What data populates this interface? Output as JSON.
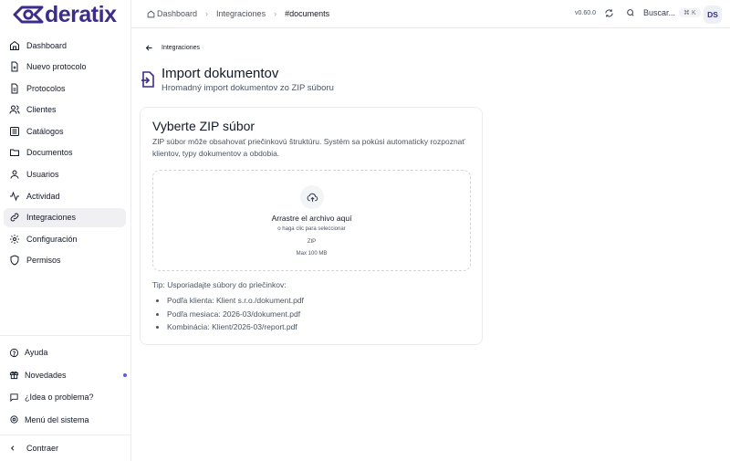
{
  "brand": {
    "logo_text": "deratix",
    "color": "#3b2d8a"
  },
  "sidebar": {
    "items": [
      {
        "label": "Dashboard",
        "icon": "home-icon"
      },
      {
        "label": "Nuevo protocolo",
        "icon": "file-plus-icon"
      },
      {
        "label": "Protocolos",
        "icon": "file-text-icon"
      },
      {
        "label": "Clientes",
        "icon": "users-icon"
      },
      {
        "label": "Catálogos",
        "icon": "list-icon"
      },
      {
        "label": "Documentos",
        "icon": "folder-icon"
      },
      {
        "label": "Usuarios",
        "icon": "user-group-icon"
      },
      {
        "label": "Actividad",
        "icon": "activity-icon"
      },
      {
        "label": "Integraciones",
        "icon": "link-icon",
        "active": true
      },
      {
        "label": "Configuración",
        "icon": "gear-icon"
      },
      {
        "label": "Permisos",
        "icon": "shield-icon"
      }
    ],
    "bottom": [
      {
        "label": "Ayuda",
        "icon": "help-circle-icon"
      },
      {
        "label": "Novedades",
        "icon": "gift-icon"
      },
      {
        "label": "¿Idea o problema?",
        "icon": "message-icon"
      },
      {
        "label": "Menú del sistema",
        "icon": "settings-icon"
      }
    ],
    "collapse_label": "Contraer"
  },
  "header": {
    "breadcrumb": [
      "Dashboard",
      "Integraciones",
      "#documents"
    ],
    "version": "v0.60.0",
    "search_label": "Buscar...",
    "search_shortcut": "⌘ K",
    "avatar_initials": "DS"
  },
  "main": {
    "back_label": "Integraciones",
    "title": "Import dokumentov",
    "subtitle": "Hromadný import dokumentov zo ZIP súboru",
    "card": {
      "title": "Vyberte ZIP súbor",
      "description": "ZIP súbor môže obsahovať priečinkovú štruktúru. Systém sa pokúsi automaticky rozpoznať klientov, typy dokumentov a obdobia.",
      "dropzone": {
        "main_text": "Arrastre el archivo aquí",
        "sub_text": "o haga clic para seleccionar",
        "file_type": "ZIP",
        "max_size": "Max 100 MB"
      },
      "tip_title": "Tip: Usporiadajte súbory do priečinkov:",
      "tips": [
        "Podľa klienta: Klient s.r.o./dokument.pdf",
        "Podľa mesiaca: 2026-03/dokument.pdf",
        "Kombinácia: Klient/2026-03/report.pdf"
      ]
    }
  }
}
